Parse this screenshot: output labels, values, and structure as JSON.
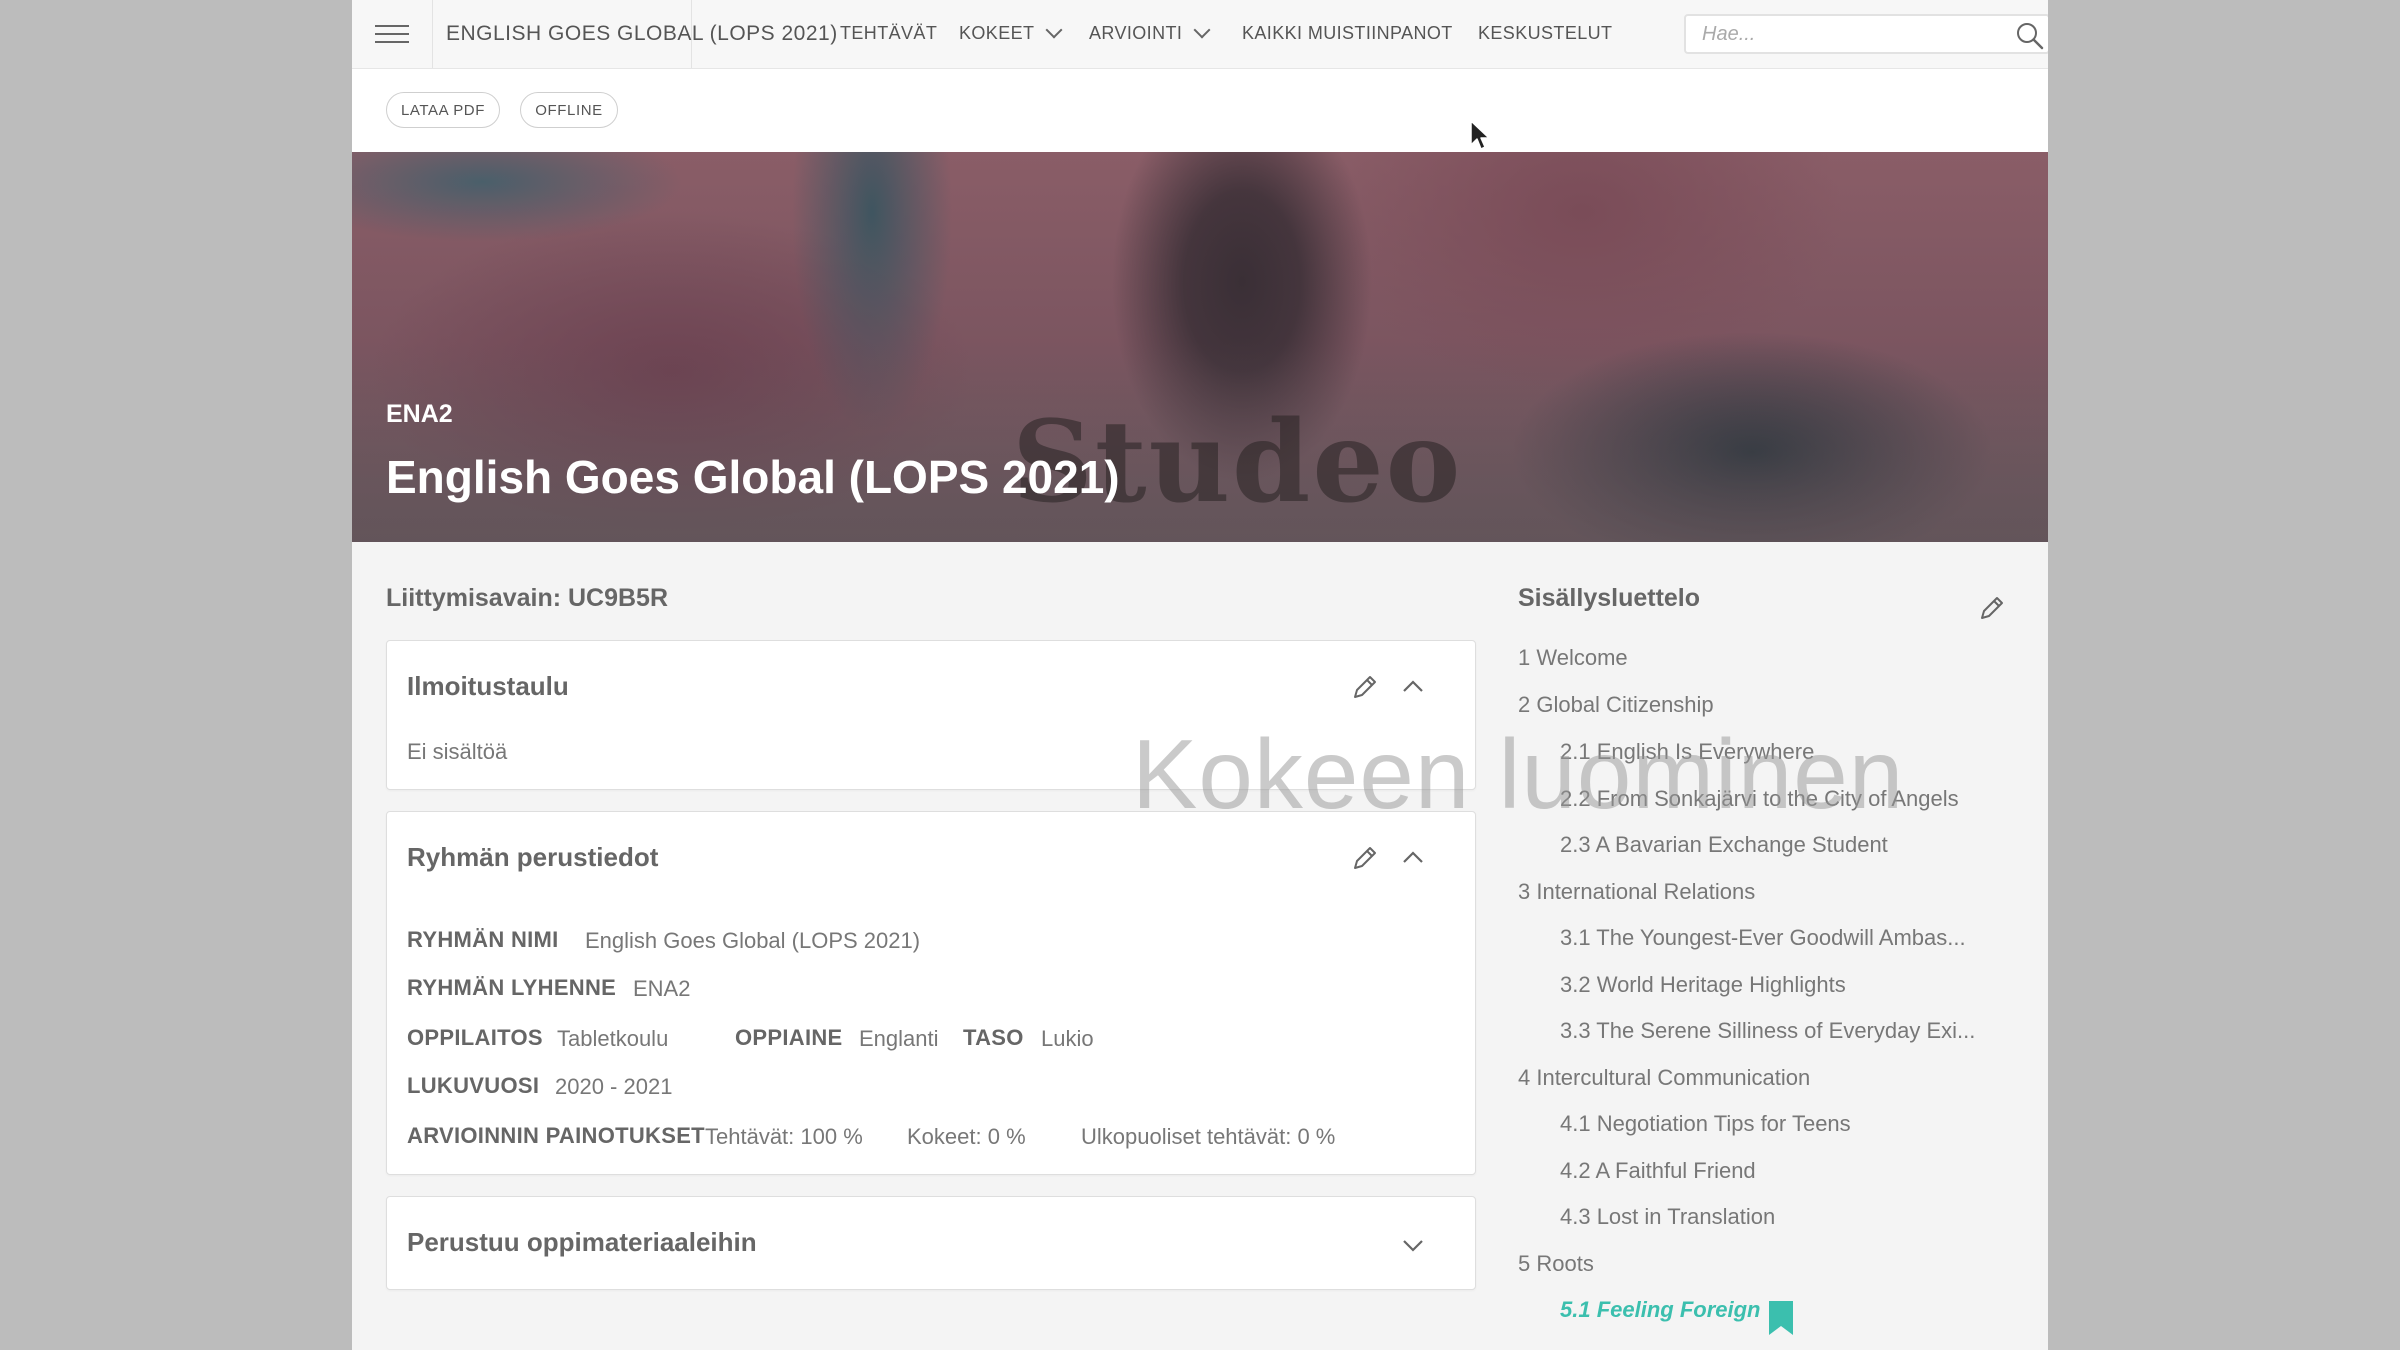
{
  "nav": {
    "course_title": "ENGLISH GOES GLOBAL (LOPS 2021)",
    "tasks": "TEHTÄVÄT",
    "exams": "KOKEET",
    "grading": "ARVIOINTI",
    "all_notes": "KAIKKI MUISTIINPANOT",
    "discussions": "KESKUSTELUT",
    "search_placeholder": "Hae..."
  },
  "actions": {
    "download_pdf": "LATAA PDF",
    "offline": "OFFLINE"
  },
  "hero": {
    "code": "ENA2",
    "title": "English Goes Global (LOPS 2021)",
    "watermark": "Studeo"
  },
  "join_key": "Liittymisavain: UC9B5R",
  "bulletin": {
    "title": "Ilmoitustaulu",
    "empty_text": "Ei sisältöä"
  },
  "group_info": {
    "title": "Ryhmän perustiedot",
    "name_label": "RYHMÄN NIMI",
    "name_value": "English Goes Global (LOPS 2021)",
    "abbr_label": "RYHMÄN LYHENNE",
    "abbr_value": "ENA2",
    "school_label": "OPPILAITOS",
    "school_value": "Tabletkoulu",
    "subject_label": "OPPIAINE",
    "subject_value": "Englanti",
    "level_label": "TASO",
    "level_value": "Lukio",
    "year_label": "LUKUVUOSI",
    "year_value": "2020 - 2021",
    "weights_label": "ARVIOINNIN PAINOTUKSET",
    "weight_tasks": "Tehtävät: 100 %",
    "weight_exams": "Kokeet: 0 %",
    "weight_external": "Ulkopuoliset tehtävät: 0 %"
  },
  "materials": {
    "title": "Perustuu oppimateriaaleihin"
  },
  "toc": {
    "title": "Sisällysluettelo",
    "items": [
      {
        "label": "1 Welcome",
        "level": 1
      },
      {
        "label": "2 Global Citizenship",
        "level": 1
      },
      {
        "label": "2.1 English Is Everywhere",
        "level": 2
      },
      {
        "label": "2.2 From Sonkajärvi to the City of Angels",
        "level": 2
      },
      {
        "label": "2.3 A Bavarian Exchange Student",
        "level": 2
      },
      {
        "label": "3 International Relations",
        "level": 1
      },
      {
        "label": "3.1 The Youngest-Ever Goodwill Ambas...",
        "level": 2
      },
      {
        "label": "3.2 World Heritage Highlights",
        "level": 2
      },
      {
        "label": "3.3 The Serene Silliness of Everyday Exi...",
        "level": 2
      },
      {
        "label": "4 Intercultural Communication",
        "level": 1
      },
      {
        "label": "4.1 Negotiation Tips for Teens",
        "level": 2
      },
      {
        "label": "4.2 A Faithful Friend",
        "level": 2
      },
      {
        "label": "4.3 Lost in Translation",
        "level": 2
      },
      {
        "label": "5 Roots",
        "level": 1
      },
      {
        "label": "5.1 Feeling Foreign",
        "level": 2,
        "active": true
      }
    ]
  },
  "overlay_watermark": "Kokeen luominen",
  "colors": {
    "accent": "#3bbfae",
    "text": "#666666",
    "page_bg": "#f4f4f4",
    "outer_bg": "#bcbcbc"
  }
}
